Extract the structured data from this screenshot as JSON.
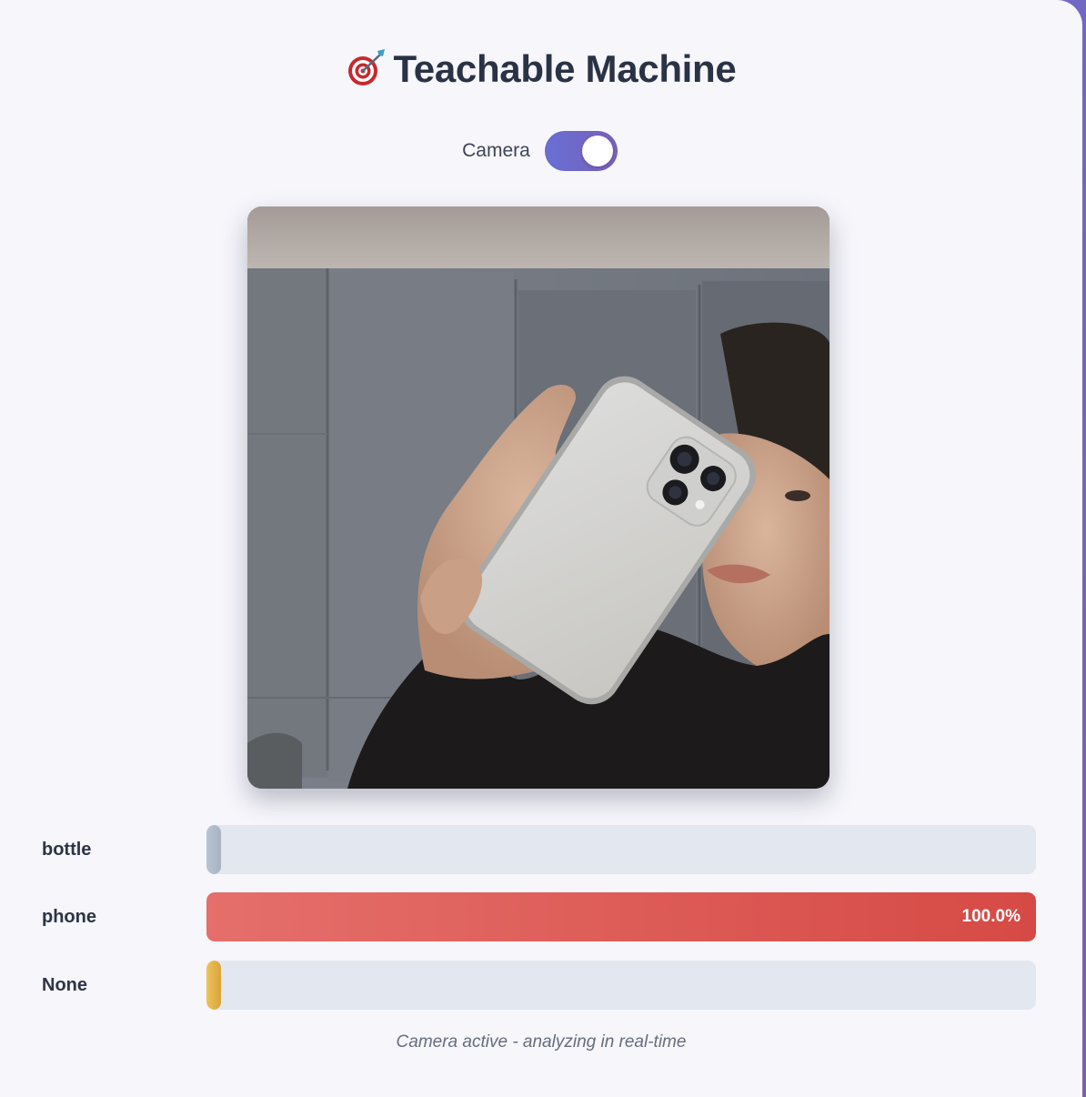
{
  "app": {
    "title": "Teachable Machine",
    "title_icon": "target-dart-icon"
  },
  "camera": {
    "label": "Camera",
    "enabled": true
  },
  "webcam": {
    "description_icon": "webcam-feed"
  },
  "predictions": [
    {
      "label": "bottle",
      "probability": 0.0,
      "value_text": "",
      "color_start": "#b9c3d1",
      "color_end": "#a7b3c4"
    },
    {
      "label": "phone",
      "probability": 1.0,
      "value_text": "100.0%",
      "color_start": "#e56f6b",
      "color_end": "#d64a45"
    },
    {
      "label": "None",
      "probability": 0.0,
      "value_text": "",
      "color_start": "#ecc45a",
      "color_end": "#dba33a"
    }
  ],
  "status": {
    "text": "Camera active - analyzing in real-time"
  },
  "colors": {
    "accent_start": "#6770d4",
    "accent_end": "#7b5fbb",
    "track": "#e3e7ef",
    "background": "#f6f6fb"
  }
}
